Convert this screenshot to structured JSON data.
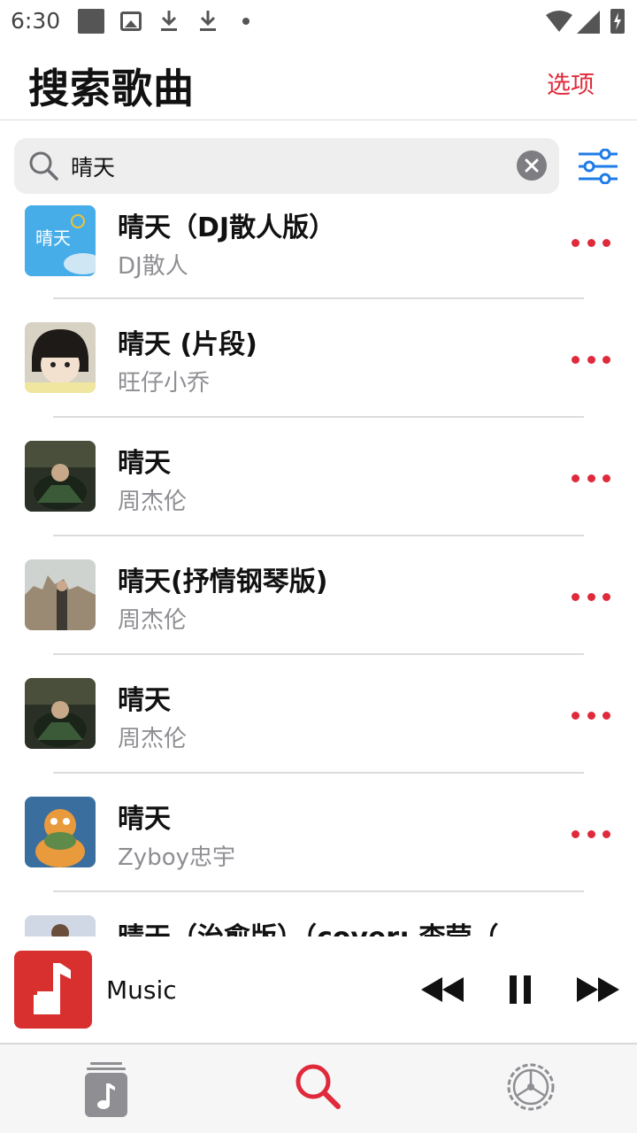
{
  "status_bar": {
    "time": "6:30",
    "icons": [
      "notification-square-icon",
      "image-icon",
      "download-icon",
      "download-icon",
      "dot-icon",
      "wifi-icon",
      "signal-icon",
      "battery-charging-icon"
    ]
  },
  "header": {
    "title": "搜索歌曲",
    "options_label": "选项"
  },
  "search": {
    "value": "晴天",
    "placeholder": ""
  },
  "songs": [
    {
      "title": "晴天（DJ散人版）",
      "artist": "DJ散人"
    },
    {
      "title": "晴天 (片段)",
      "artist": "旺仔小乔"
    },
    {
      "title": "晴天",
      "artist": "周杰伦"
    },
    {
      "title": "晴天(抒情钢琴版)",
      "artist": "周杰伦"
    },
    {
      "title": "晴天",
      "artist": "周杰伦"
    },
    {
      "title": "晴天",
      "artist": "Zyboy忠宇"
    },
    {
      "title": "晴天（治愈版）（cover: 李莹（…",
      "artist": ""
    }
  ],
  "artwork": [
    {
      "lettering": "晴天"
    }
  ],
  "player": {
    "title": "Music"
  },
  "tabs": [
    {
      "icon": "music-library-icon",
      "active": false
    },
    {
      "icon": "search-icon",
      "active": true
    },
    {
      "icon": "settings-icon",
      "active": false
    }
  ],
  "colors": {
    "accent": "#e02a3c",
    "filter_blue": "#1e7be8",
    "secondary_text": "#8e8e93",
    "player_art": "#d82f2f"
  }
}
